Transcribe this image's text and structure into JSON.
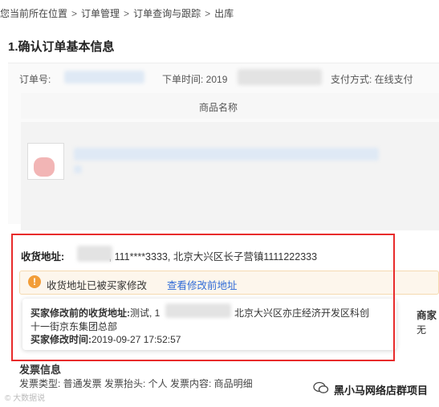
{
  "breadcrumb": {
    "prefix": "您当前所在位置",
    "items": [
      "订单管理",
      "订单查询与跟踪",
      "出库"
    ],
    "separator": ">"
  },
  "section_title": "1.确认订单基本信息",
  "order": {
    "order_no_label": "订单号:",
    "order_time_label": "下单时间: 2019",
    "payment": "支付方式: 在线支付"
  },
  "product": {
    "header": "商品名称"
  },
  "address": {
    "label": "收货地址:",
    "value": ", 111****3333, 北京大兴区长子营镇1111222333"
  },
  "warning": {
    "icon": "!",
    "text": "收货地址已被买家修改",
    "link": "查看修改前地址"
  },
  "tooltip": {
    "prev_addr_label": "买家修改前的收货地址:",
    "prev_addr_value_a": "测试, 1",
    "prev_addr_value_b": "北京大兴区亦庄经济开发区科创",
    "prev_addr_value_c": "十一街京东集团总部",
    "time_label": "买家修改时间:",
    "time_value": "2019-09-27 17:52:57"
  },
  "side": {
    "shop_label": "商家",
    "shop_value": "无"
  },
  "invoice": {
    "title": "发票信息",
    "line": "发票类型: 普通发票  发票抬头: 个人  发票内容: 商品明细"
  },
  "watermark": {
    "left": "© 大数据说",
    "right": "黑小马网络店群项目"
  },
  "colors": {
    "highlight_frame": "#e82b2b",
    "link": "#2f6bd7",
    "warning_icon": "#f29d38"
  }
}
